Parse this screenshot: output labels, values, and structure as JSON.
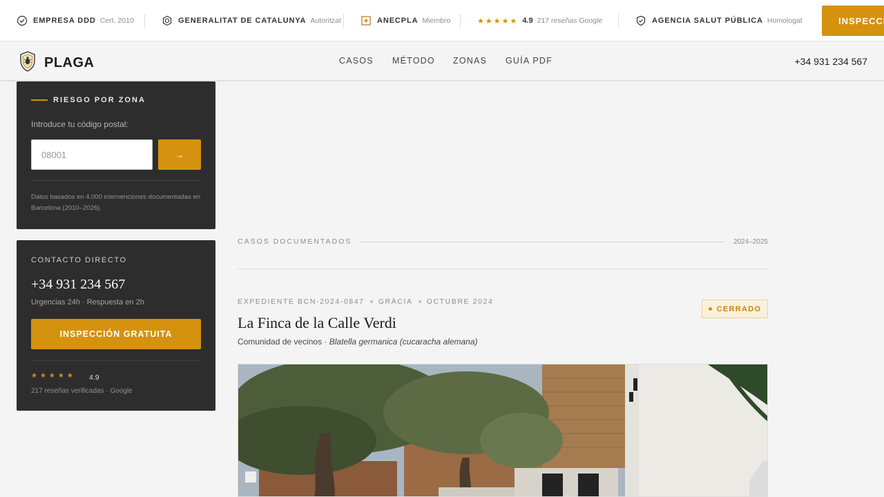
{
  "trustbar": {
    "items": [
      {
        "icon": "check-circle-icon",
        "label": "EMPRESA DDD",
        "sub": "Cert. 2010"
      },
      {
        "icon": "hexagon-icon",
        "label": "GENERALITAT DE CATALUNYA",
        "sub": "Autoritzat"
      },
      {
        "icon": "plus-box-icon",
        "label": "ANECPLA",
        "sub": "Miembro"
      },
      {
        "icon": "stars-icon",
        "stars": "★★★★★",
        "rating": "4.9",
        "sub": "217 reseñas Google"
      },
      {
        "icon": "shield-check-icon",
        "label": "AGENCIA SALUT PÚBLICA",
        "sub": "Homologat"
      }
    ],
    "cta": "INSPECCIÓN GRATUITA"
  },
  "nav": {
    "logo_text": "PLAGA",
    "links": [
      "CASOS",
      "MÉTODO",
      "ZONAS",
      "GUÍA PDF"
    ],
    "phone": "+34 931 234 567"
  },
  "sidebar": {
    "risk": {
      "title": "RIESGO POR ZONA",
      "prompt": "Introduce tu código postal:",
      "placeholder": "08001",
      "button": "→",
      "note": "Datos basados en 4.000 intervenciones documentadas en Barcelona (2010–2026)."
    },
    "contact": {
      "title": "CONTACTO DIRECTO",
      "phone": "+34 931 234 567",
      "urgency": "Urgencias 24h · Respuesta en 2h",
      "cta": "INSPECCIÓN GRATUITA",
      "stars": "★★★★★",
      "rating": "4.9",
      "reviews": "217 reseñas verificadas · Google"
    }
  },
  "main": {
    "section_title": "CASOS DOCUMENTADOS",
    "section_range": "2024–2025",
    "case": {
      "expediente": "EXPEDIENTE BCN-2024-0847",
      "zona": "GRÀCIA",
      "fecha": "OCTUBRE 2024",
      "status": "CERRADO",
      "title": "La Finca de la Calle Verdi",
      "client": "Comunidad de vecinos · ",
      "species": "Blatella germanica (cucaracha alemana)"
    }
  },
  "colors": {
    "accent": "#d4920f",
    "card_bg": "#2d2d2d",
    "page_bg": "#f4f4f4"
  }
}
